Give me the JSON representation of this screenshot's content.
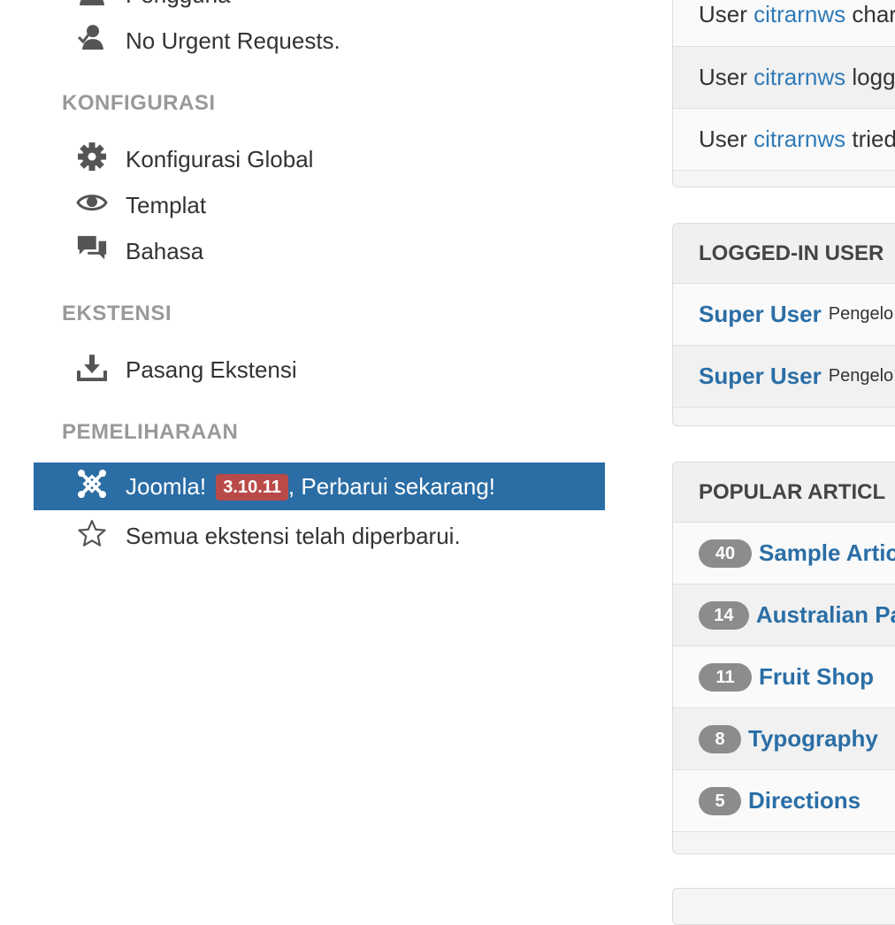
{
  "nav": {
    "partial_top_label": "Pengguna",
    "no_urgent": "No Urgent Requests.",
    "sections": {
      "konfigurasi": "KONFIGURASI",
      "ekstensi": "EKSTENSI",
      "pemeliharaan": "PEMELIHARAAN"
    },
    "konfigurasi_global": "Konfigurasi Global",
    "templat": "Templat",
    "bahasa": "Bahasa",
    "pasang_ekstensi": "Pasang Ekstensi",
    "joomla_label": "Joomla!",
    "joomla_version": "3.10.11",
    "joomla_update": ", Perbarui sekarang!",
    "all_updated": "Semua ekstensi telah diperbarui."
  },
  "activity": {
    "rows": [
      {
        "prefix": "User",
        "user": "citrarnws",
        "suffix": "char"
      },
      {
        "prefix": "User",
        "user": "citrarnws",
        "suffix": "logg"
      },
      {
        "prefix": "User",
        "user": "citrarnws",
        "suffix": "tried"
      }
    ]
  },
  "logged_in": {
    "title": "LOGGED-IN USER",
    "rows": [
      {
        "name": "Super User",
        "role": "Pengelo"
      },
      {
        "name": "Super User",
        "role": "Pengelo"
      }
    ]
  },
  "popular": {
    "title": "POPULAR ARTICL",
    "rows": [
      {
        "count": "40",
        "title": "Sample Artic"
      },
      {
        "count": "14",
        "title": "Australian Pa"
      },
      {
        "count": "11",
        "title": "Fruit Shop"
      },
      {
        "count": "8",
        "title": "Typography"
      },
      {
        "count": "5",
        "title": "Directions"
      }
    ]
  },
  "colors": {
    "active_bg": "#2b6da5",
    "version_badge": "#b94a48",
    "link": "#2f7ab8"
  }
}
